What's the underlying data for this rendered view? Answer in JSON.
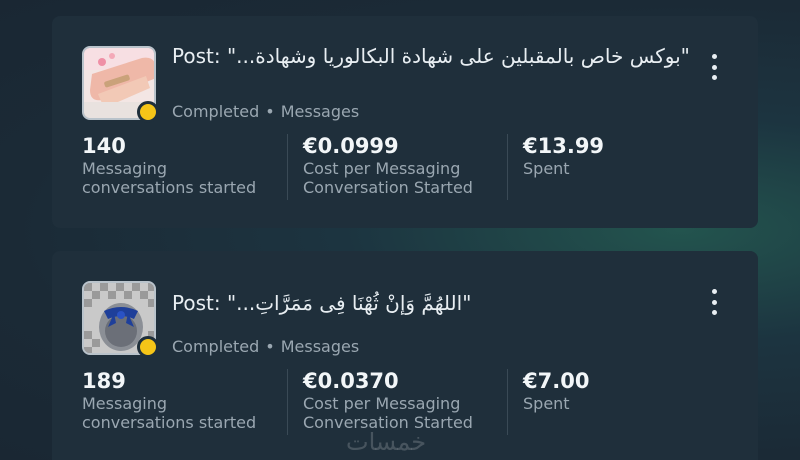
{
  "cards": [
    {
      "title_prefix": "Post: ",
      "title_text": "\"بوكس خاص بالمقبلين على شهادة البكالوريا وشهادة...\"",
      "status": "Completed",
      "separator": "•",
      "type": "Messages",
      "metrics": [
        {
          "value": "140",
          "label": "Messaging conversations started"
        },
        {
          "value": "€0.0999",
          "label": "Cost per Messaging Conversation Started"
        },
        {
          "value": "€13.99",
          "label": "Spent"
        }
      ]
    },
    {
      "title_prefix": "Post: ",
      "title_text": "\"اللهُمَّ وَإنْ ثُهْنَا فِى مَمَرَّاتِ...\"",
      "status": "Completed",
      "separator": "•",
      "type": "Messages",
      "metrics": [
        {
          "value": "189",
          "label": "Messaging conversations started"
        },
        {
          "value": "€0.0370",
          "label": "Cost per Messaging Conversation Started"
        },
        {
          "value": "€7.00",
          "label": "Spent"
        }
      ]
    }
  ],
  "watermark": "خمسات",
  "colors": {
    "card_bg": "#1f2f3b",
    "status_dot": "#f5c518",
    "text_primary": "#e8eef2",
    "text_secondary": "#9aa7b1"
  }
}
